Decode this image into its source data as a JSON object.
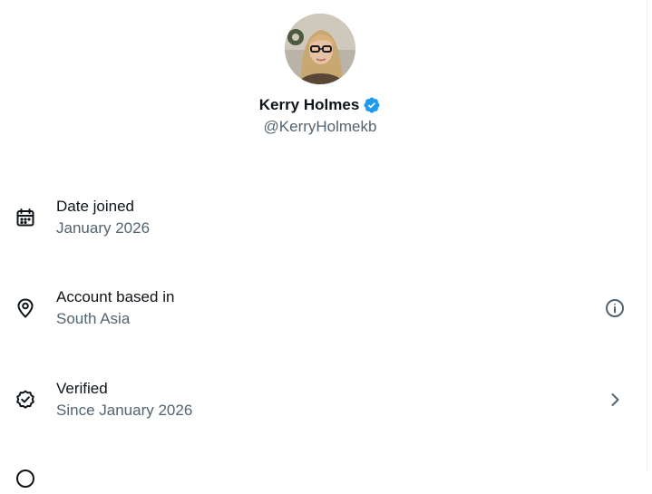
{
  "profile": {
    "display_name": "Kerry Holmes",
    "handle": "@KerryHolmekb",
    "verified": true,
    "badge_color": "#1d9bf0"
  },
  "rows": [
    {
      "title": "Date joined",
      "subtitle": "January 2026",
      "icon": "calendar-icon"
    },
    {
      "title": "Account based in",
      "subtitle": "South Asia",
      "icon": "location-pin-icon",
      "action_icon": "info-icon"
    },
    {
      "title": "Verified",
      "subtitle": "Since January 2026",
      "icon": "verified-check-icon",
      "action_icon": "chevron-right-icon"
    }
  ],
  "colors": {
    "primary_text": "#0f1419",
    "secondary_text": "#536471",
    "accent": "#1d9bf0"
  }
}
